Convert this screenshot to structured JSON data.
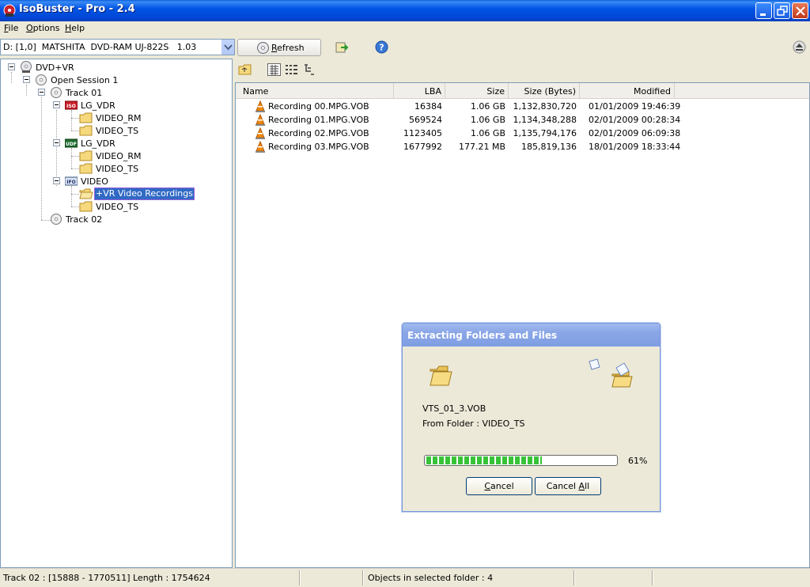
{
  "window": {
    "title": "IsoBuster - Pro - 2.4",
    "controls": [
      "minimize",
      "restore",
      "close"
    ]
  },
  "menu": {
    "items": [
      {
        "label": "File",
        "accel": "F",
        "rest": "ile"
      },
      {
        "label": "Options",
        "accel": "O",
        "rest": "ptions"
      },
      {
        "label": "Help",
        "accel": "H",
        "rest": "elp"
      }
    ]
  },
  "toolbar": {
    "drive_value": "D: [1,0]  MATSHITA  DVD-RAM UJ-822S   1.03",
    "refresh_label": "Refresh",
    "refresh_accel": "R",
    "refresh_rest": "efresh"
  },
  "tree": {
    "nodes": [
      {
        "label": "DVD+VR",
        "icon": "dvd-disc-icon"
      },
      {
        "label": "Open Session 1",
        "icon": "session-disc-icon"
      },
      {
        "label": "Track 01",
        "icon": "track-disc-icon"
      },
      {
        "label": "LG_VDR",
        "icon": "iso-filesystem-icon",
        "badge": "ISO"
      },
      {
        "label": "VIDEO_RM",
        "icon": "folder-icon"
      },
      {
        "label": "VIDEO_TS",
        "icon": "folder-icon"
      },
      {
        "label": "LG_VDR",
        "icon": "udf-filesystem-icon",
        "badge": "UDF"
      },
      {
        "label": "VIDEO_RM",
        "icon": "folder-icon"
      },
      {
        "label": "VIDEO_TS",
        "icon": "folder-icon"
      },
      {
        "label": "VIDEO",
        "icon": "ifo-filesystem-icon",
        "badge": "IFO"
      },
      {
        "label": "+VR Video Recordings",
        "icon": "folder-open-icon",
        "selected": true
      },
      {
        "label": "VIDEO_TS",
        "icon": "folder-icon"
      },
      {
        "label": "Track 02",
        "icon": "track-disc-icon"
      }
    ]
  },
  "list": {
    "columns": {
      "name": "Name",
      "lba": "LBA",
      "size": "Size",
      "size_bytes": "Size (Bytes)",
      "modified": "Modified"
    },
    "rows": [
      {
        "name": "Recording 00.MPG.VOB",
        "lba": "16384",
        "size": "1.06 GB",
        "size_bytes": "1,132,830,720",
        "modified": "01/01/2009 19:46:39"
      },
      {
        "name": "Recording 01.MPG.VOB",
        "lba": "569524",
        "size": "1.06 GB",
        "size_bytes": "1,134,348,288",
        "modified": "02/01/2009 00:28:34"
      },
      {
        "name": "Recording 02.MPG.VOB",
        "lba": "1123405",
        "size": "1.06 GB",
        "size_bytes": "1,135,794,176",
        "modified": "02/01/2009 06:09:38"
      },
      {
        "name": "Recording 03.MPG.VOB",
        "lba": "1677992",
        "size": "177.21 MB",
        "size_bytes": "185,819,136",
        "modified": "18/01/2009 18:33:44"
      }
    ]
  },
  "status": {
    "left": "Track 02 : [15888 - 1770511]  Length : 1754624",
    "right": "Objects in selected folder : 4"
  },
  "dialog": {
    "title": "Extracting Folders and Files",
    "filename": "VTS_01_3.VOB",
    "folder_line": "From Folder : VIDEO_TS",
    "progress_fraction": 0.61,
    "progress_text": "61%",
    "cancel_label": "Cancel",
    "cancel_accel": "C",
    "cancel_rest": "ancel",
    "cancel_all_prefix": "Cancel ",
    "cancel_all_accel": "A",
    "cancel_all_rest": "ll"
  },
  "colors": {
    "titlebar": "#0055e5",
    "selection": "#316ac5",
    "progress": "#37c337"
  }
}
